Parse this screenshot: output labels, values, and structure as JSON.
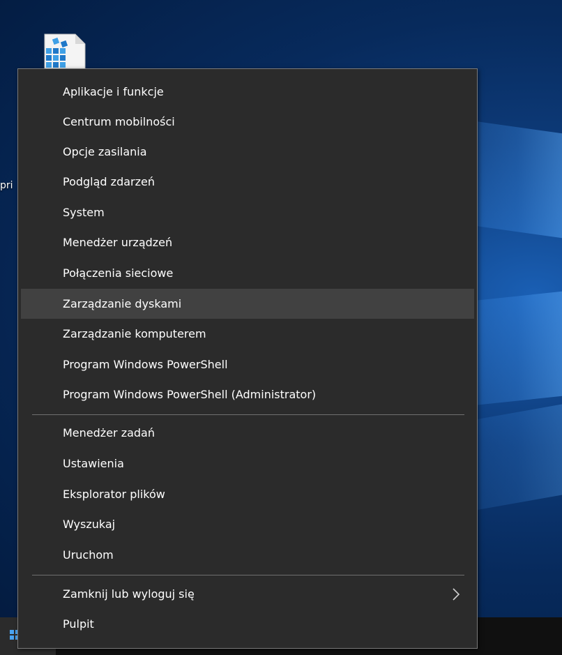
{
  "desktop": {
    "partial_icon_label": "pri"
  },
  "context_menu": {
    "group1": [
      {
        "label": "Aplikacje i funkcje"
      },
      {
        "label": "Centrum mobilności"
      },
      {
        "label": "Opcje zasilania"
      },
      {
        "label": "Podgląd zdarzeń"
      },
      {
        "label": "System"
      },
      {
        "label": "Menedżer urządzeń"
      },
      {
        "label": "Połączenia sieciowe"
      },
      {
        "label": "Zarządzanie dyskami",
        "highlighted": true
      },
      {
        "label": "Zarządzanie komputerem"
      },
      {
        "label": "Program Windows PowerShell"
      },
      {
        "label": "Program Windows PowerShell (Administrator)"
      }
    ],
    "group2": [
      {
        "label": "Menedżer zadań"
      },
      {
        "label": "Ustawienia"
      },
      {
        "label": "Eksplorator plików"
      },
      {
        "label": "Wyszukaj"
      },
      {
        "label": "Uruchom"
      }
    ],
    "group3": [
      {
        "label": "Zamknij lub wyloguj się",
        "has_submenu": true,
        "submenu_icon": "chevron-right-icon"
      },
      {
        "label": "Pulpit"
      }
    ]
  },
  "colors": {
    "menu_background": "#2b2b2b",
    "menu_highlight": "#414141",
    "menu_text": "#ffffff",
    "menu_border": "#7a7a7a",
    "taskbar": "#101010",
    "accent_blue": "#4aa3f0"
  }
}
